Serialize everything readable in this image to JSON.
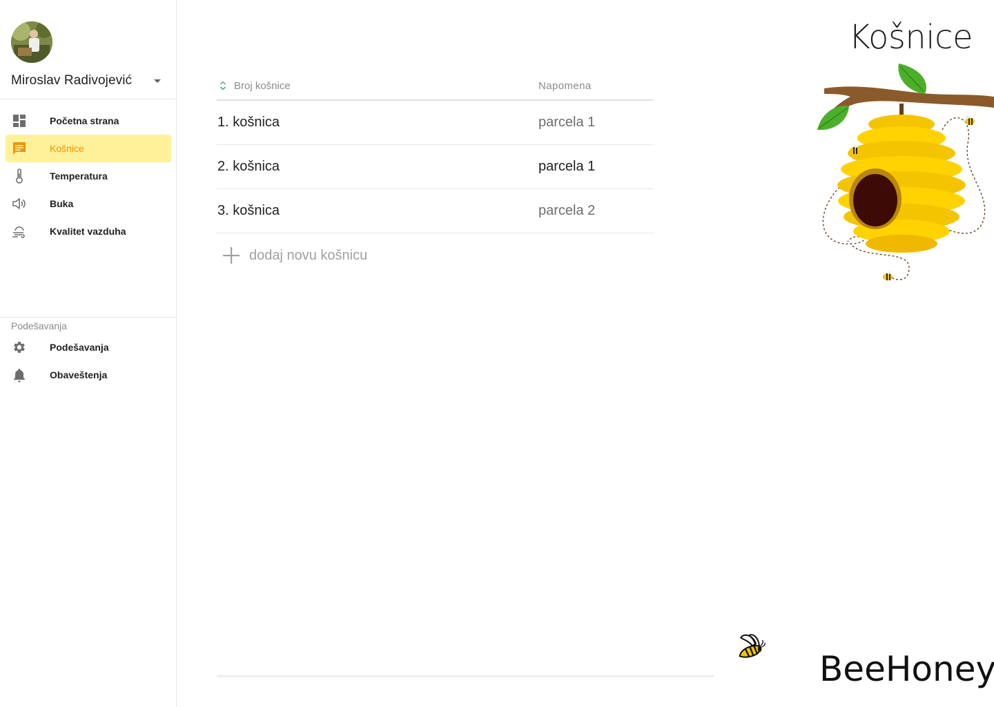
{
  "page": {
    "title": "Košnice"
  },
  "user": {
    "name": "Miroslav Radivojević"
  },
  "nav": {
    "items": [
      {
        "label": "Početna strana",
        "icon": "dashboard-icon"
      },
      {
        "label": "Košnice",
        "icon": "chat-icon",
        "active": true
      },
      {
        "label": "Temperatura",
        "icon": "thermometer-icon"
      },
      {
        "label": "Buka",
        "icon": "speaker-icon"
      },
      {
        "label": "Kvalitet vazduha",
        "icon": "air-quality-icon"
      }
    ],
    "settings_heading": "Podešavanja",
    "settings_items": [
      {
        "label": "Podešavanja",
        "icon": "gear-icon"
      },
      {
        "label": "Obaveštenja",
        "icon": "bell-icon"
      }
    ]
  },
  "table": {
    "col_number": "Broj košnice",
    "col_note": "Napomena",
    "rows": [
      {
        "number": "1. košnica",
        "note": "parcela 1"
      },
      {
        "number": "2. košnica",
        "note": "parcela 1"
      },
      {
        "number": "3. košnica",
        "note": "parcela 2"
      }
    ],
    "add_label": "dodaj novu košnicu"
  },
  "brand": {
    "name": "BeeHoney"
  },
  "colors": {
    "accent": "#f39200",
    "active_bg": "#fff199",
    "sort_icon": "#26a69a"
  }
}
